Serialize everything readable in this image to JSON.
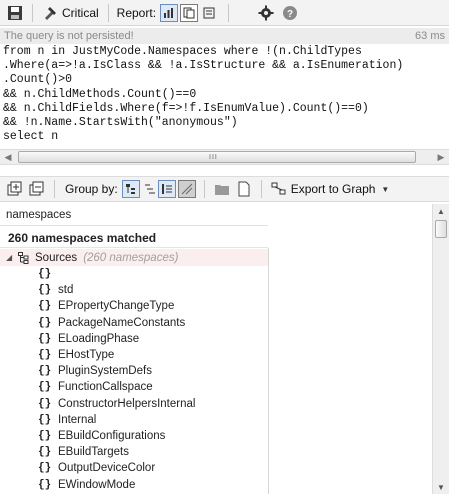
{
  "toolbar": {
    "critical_label": "Critical",
    "report_label": "Report:"
  },
  "status": {
    "message": "The query is not persisted!",
    "time": "63 ms"
  },
  "query": {
    "lines": [
      "from n in JustMyCode.Namespaces where !(n.ChildTypes",
      ".Where(a=>!a.IsClass && !a.IsStructure && a.IsEnumeration)",
      ".Count()>0",
      "&& n.ChildMethods.Count()==0",
      "&& n.ChildFields.Where(f=>!f.IsEnumValue).Count()==0)",
      "&& !n.Name.StartsWith(\"anonymous\")",
      "select n"
    ]
  },
  "hscroll": {
    "grip": "III"
  },
  "results_toolbar": {
    "group_by_label": "Group by:",
    "export_label": "Export to Graph"
  },
  "filter": {
    "value": "namespaces"
  },
  "results": {
    "heading": "260 namespaces matched",
    "root_label": "Sources",
    "root_count": "(260 namespaces)",
    "items": [
      {
        "name": ""
      },
      {
        "name": "std"
      },
      {
        "name": "EPropertyChangeType"
      },
      {
        "name": "PackageNameConstants"
      },
      {
        "name": "ELoadingPhase"
      },
      {
        "name": "EHostType"
      },
      {
        "name": "PluginSystemDefs"
      },
      {
        "name": "FunctionCallspace"
      },
      {
        "name": "ConstructorHelpersInternal"
      },
      {
        "name": "Internal"
      },
      {
        "name": "EBuildConfigurations"
      },
      {
        "name": "EBuildTargets"
      },
      {
        "name": "OutputDeviceColor"
      },
      {
        "name": "EWindowMode"
      }
    ],
    "item_icon": "{}"
  },
  "icons": {
    "save": "save-icon",
    "critical": "critical-icon",
    "report_1": "report-table-icon",
    "report_2": "report-chart-icon",
    "report_3": "report-list-icon",
    "settings": "gear-icon",
    "help": "help-icon"
  }
}
